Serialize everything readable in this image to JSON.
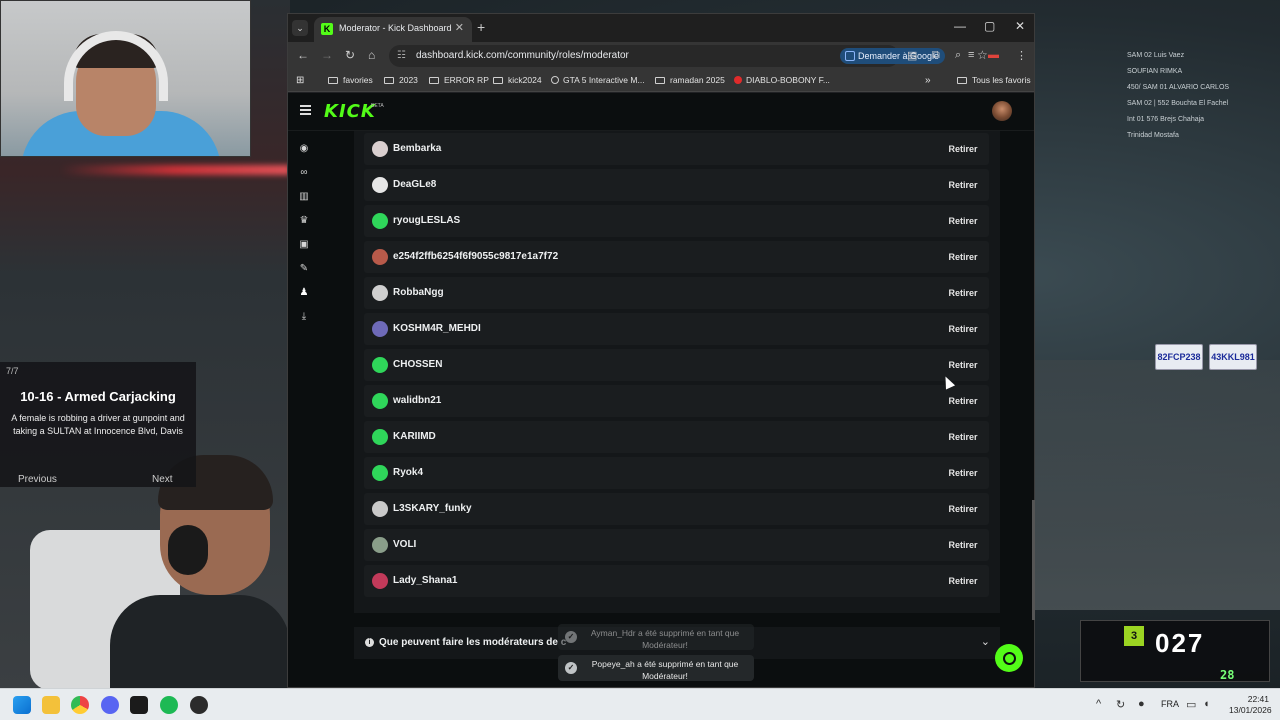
{
  "overlay": {
    "alert_count": "7/7",
    "alert_title": "10-16 - Armed Carjacking",
    "alert_desc": "A female is robbing a driver at gunpoint and taking a SULTAN at Innocence Blvd, Davis",
    "prev_label": "Previous",
    "next_label": "Next",
    "hud_names": [
      "SAM 02 Luis Vaez",
      "SOUFIAN RIMKA",
      "450/ SAM 01 ALVARIO CARLOS",
      "SAM 02 | 552 Bouchta El Fachel",
      "Int 01 576 Brejs Chahaja",
      "Trinidad Mostafa"
    ],
    "plates": [
      "82FCP238",
      "43KKL981"
    ],
    "speed": "027",
    "gear": "3",
    "fuel": "28"
  },
  "browser": {
    "tab_title": "Moderator - Kick Dashboard",
    "url": "dashboard.kick.com/community/roles/moderator",
    "ask_google": "Demander à Google",
    "bookmarks": [
      "favories",
      "2023",
      "ERROR RP",
      "kick2024",
      "GTA 5 Interactive M...",
      "ramadan 2025",
      "DIABLO-BOBONY F..."
    ],
    "all_favorites": "Tous les favoris"
  },
  "kick": {
    "logo": "KICK",
    "beta": "BETA",
    "remove_label": "Retirer",
    "moderators": [
      {
        "name": "Bembarka",
        "color": "#d9cfcf"
      },
      {
        "name": "DeaGLe8",
        "color": "#e6e6e6"
      },
      {
        "name": "ryougLESLAS",
        "color": "#2fd65a"
      },
      {
        "name": "e254f2ffb6254f6f9055c9817e1a7f72",
        "color": "#b85a4a"
      },
      {
        "name": "RobbaNgg",
        "color": "#cfcfcf"
      },
      {
        "name": "KOSHM4R_MEHDI",
        "color": "#6e6ab8"
      },
      {
        "name": "CHOSSEN",
        "color": "#2fd65a"
      },
      {
        "name": "walidbn21",
        "color": "#2fd65a"
      },
      {
        "name": "KARIIMD",
        "color": "#2fd65a"
      },
      {
        "name": "Ryok4",
        "color": "#2fd65a"
      },
      {
        "name": "L3SKARY_funky",
        "color": "#c9c9c9"
      },
      {
        "name": "VOLI",
        "color": "#8a9e8a"
      },
      {
        "name": "Lady_Shana1",
        "color": "#c23a5a"
      }
    ],
    "faq_label": "Que peuvent faire les modérateurs de c",
    "toasts": [
      {
        "text": "Ayman_Hdr a été supprimé en tant que Modérateur!"
      },
      {
        "text": "Popeye_ah a été supprimé en tant que Modérateur!"
      }
    ]
  },
  "taskbar": {
    "lang": "FRA",
    "time": "22:41",
    "date": "13/01/2026"
  },
  "colors": {
    "kick_green": "#53fc18",
    "page_bg": "#0b0e0f",
    "panel_bg": "#141719"
  }
}
